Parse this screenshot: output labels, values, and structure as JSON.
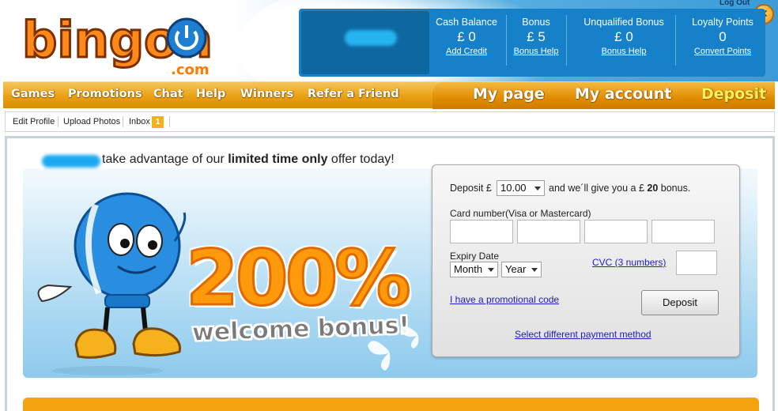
{
  "header": {
    "logo": {
      "word": "bingon",
      "domain": ".com"
    },
    "logout": "Log Out",
    "close": "✕",
    "stats": [
      {
        "label": "Cash Balance",
        "value": "£ 0",
        "link": "Add Credit"
      },
      {
        "label": "Bonus",
        "value": "£ 5",
        "link": "Bonus Help"
      },
      {
        "label": "Unqualified Bonus",
        "value": "£ 0",
        "link": "Bonus Help"
      },
      {
        "label": "Loyalty Points",
        "value": "0",
        "link": "Convert Points"
      }
    ]
  },
  "nav": {
    "items": [
      "Games",
      "Promotions",
      "Chat",
      "Help",
      "Winners",
      "Refer a Friend"
    ],
    "my_page": "My page",
    "my_account": "My account",
    "deposit": "Deposit"
  },
  "subnav": {
    "edit_profile": "Edit Profile",
    "upload_photos": "Upload Photos",
    "inbox": "Inbox",
    "inbox_count": "1"
  },
  "promo": {
    "headline_pre": "take advantage of our ",
    "headline_bold": "limited time only",
    "headline_post": " offer today!",
    "percent": "200%",
    "welcome": "welcome bonus!"
  },
  "form": {
    "deposit_label": "Deposit £",
    "amount": "10.00",
    "give_pre": "and we´ll give you a £",
    "give_amount": "20",
    "give_post": "bonus.",
    "card_label": "Card number(Visa or Mastercard)",
    "expiry_label": "Expiry Date",
    "month": "Month",
    "year": "Year",
    "cvc_link": "CVC (3 numbers)",
    "promo_link": "I have a promotional code",
    "deposit_button": "Deposit",
    "payment_link": "Select different payment method"
  },
  "colors": {
    "header_blue": "#1680c8",
    "nav_orange": "#e9a013",
    "deposit_yellow": "#fff15a",
    "link_blue": "#2020c0"
  }
}
